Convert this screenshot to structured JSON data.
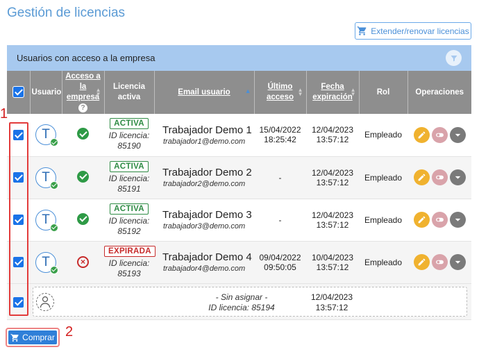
{
  "page": {
    "title": "Gestión de licencias"
  },
  "toolbar": {
    "extend_label": "Extender/renovar licencias"
  },
  "panel": {
    "title": "Usuarios con acceso a la empresa"
  },
  "table": {
    "headers": {
      "usuario": "Usuario",
      "acceso": "Acceso a la empresa",
      "licencia": "Licencia activa",
      "email": "Email usuario",
      "ultimo": "Último acceso",
      "expiracion": "Fecha expiración",
      "rol": "Rol",
      "operaciones": "Operaciones"
    },
    "rows": [
      {
        "avatar": "T",
        "access": "ok",
        "status": "ACTIVA",
        "lic_label": "ID licencia:",
        "lic_id": "85190",
        "name": "Trabajador Demo 1",
        "email": "trabajador1@demo.com",
        "last_date": "15/04/2022",
        "last_time": "18:25:42",
        "exp_date": "12/04/2023",
        "exp_time": "13:57:12",
        "role": "Empleado"
      },
      {
        "avatar": "T",
        "access": "ok",
        "status": "ACTIVA",
        "lic_label": "ID licencia:",
        "lic_id": "85191",
        "name": "Trabajador Demo 2",
        "email": "trabajador2@demo.com",
        "last_date": "-",
        "last_time": "",
        "exp_date": "12/04/2023",
        "exp_time": "13:57:12",
        "role": "Empleado"
      },
      {
        "avatar": "T",
        "access": "ok",
        "status": "ACTIVA",
        "lic_label": "ID licencia:",
        "lic_id": "85192",
        "name": "Trabajador Demo 3",
        "email": "trabajador3@demo.com",
        "last_date": "-",
        "last_time": "",
        "exp_date": "12/04/2023",
        "exp_time": "13:57:12",
        "role": "Empleado"
      },
      {
        "avatar": "T",
        "access": "denied",
        "status": "EXPIRADA",
        "lic_label": "ID licencia:",
        "lic_id": "85193",
        "name": "Trabajador Demo 4",
        "email": "trabajador4@demo.com",
        "last_date": "09/04/2022",
        "last_time": "09:50:05",
        "exp_date": "10/04/2023",
        "exp_time": "13:57:12",
        "role": "Empleado"
      }
    ],
    "unassigned": {
      "label": "- Sin asignar -",
      "lic_text": "ID licencia: 85194",
      "exp_date": "12/04/2023",
      "exp_time": "13:57:12"
    }
  },
  "annotations": {
    "marker1": "1",
    "marker2": "2"
  },
  "footer": {
    "buy_label": "Comprar"
  },
  "colors": {
    "accent": "#2f7fd8",
    "header_bg": "#8e8e8e",
    "panel_bg": "#a7c9ef",
    "active": "#2e8b44",
    "expired": "#c72b2b",
    "marker": "#d42020"
  }
}
